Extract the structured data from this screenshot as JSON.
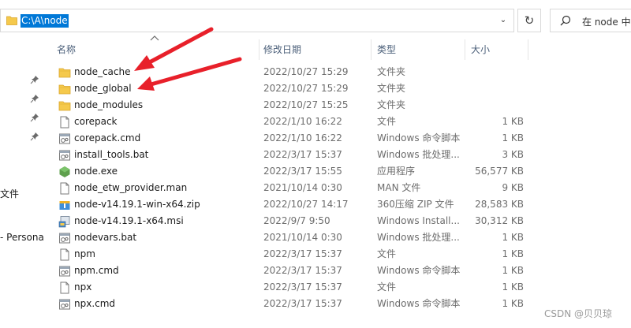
{
  "address_bar": {
    "path": "C:\\A\\node",
    "dropdown_icon": "chevron-down-icon"
  },
  "refresh": {
    "icon": "refresh-icon",
    "glyph": "↻"
  },
  "search": {
    "placeholder": "在 node 中"
  },
  "nav_pane": {
    "item_file": "文件",
    "item_personal": "- Persona"
  },
  "columns": {
    "name": "名称",
    "date": "修改日期",
    "type": "类型",
    "size": "大小"
  },
  "files": [
    {
      "name": "node_cache",
      "date": "2022/10/27 15:29",
      "type": "文件夹",
      "size": "",
      "icon": "folder"
    },
    {
      "name": "node_global",
      "date": "2022/10/27 15:29",
      "type": "文件夹",
      "size": "",
      "icon": "folder"
    },
    {
      "name": "node_modules",
      "date": "2022/10/27 15:25",
      "type": "文件夹",
      "size": "",
      "icon": "folder"
    },
    {
      "name": "corepack",
      "date": "2022/1/10 16:22",
      "type": "文件",
      "size": "1 KB",
      "icon": "file"
    },
    {
      "name": "corepack.cmd",
      "date": "2022/1/10 16:22",
      "type": "Windows 命令脚本",
      "size": "1 KB",
      "icon": "cmd"
    },
    {
      "name": "install_tools.bat",
      "date": "2022/3/17 15:37",
      "type": "Windows 批处理...",
      "size": "3 KB",
      "icon": "cmd"
    },
    {
      "name": "node.exe",
      "date": "2022/3/17 15:55",
      "type": "应用程序",
      "size": "56,577 KB",
      "icon": "node"
    },
    {
      "name": "node_etw_provider.man",
      "date": "2021/10/14 0:30",
      "type": "MAN 文件",
      "size": "9 KB",
      "icon": "file"
    },
    {
      "name": "node-v14.19.1-win-x64.zip",
      "date": "2022/10/27 14:17",
      "type": "360压缩 ZIP 文件",
      "size": "28,583 KB",
      "icon": "zip"
    },
    {
      "name": "node-v14.19.1-x64.msi",
      "date": "2022/9/7 9:50",
      "type": "Windows Install...",
      "size": "30,312 KB",
      "icon": "msi"
    },
    {
      "name": "nodevars.bat",
      "date": "2021/10/14 0:30",
      "type": "Windows 批处理...",
      "size": "1 KB",
      "icon": "cmd"
    },
    {
      "name": "npm",
      "date": "2022/3/17 15:37",
      "type": "文件",
      "size": "1 KB",
      "icon": "file"
    },
    {
      "name": "npm.cmd",
      "date": "2022/3/17 15:37",
      "type": "Windows 命令脚本",
      "size": "1 KB",
      "icon": "cmd"
    },
    {
      "name": "npx",
      "date": "2022/3/17 15:37",
      "type": "文件",
      "size": "1 KB",
      "icon": "file"
    },
    {
      "name": "npx.cmd",
      "date": "2022/3/17 15:37",
      "type": "Windows 命令脚本",
      "size": "1 KB",
      "icon": "cmd"
    }
  ],
  "annotation_color": "#e8202a",
  "watermark": "CSDN @贝贝琼"
}
